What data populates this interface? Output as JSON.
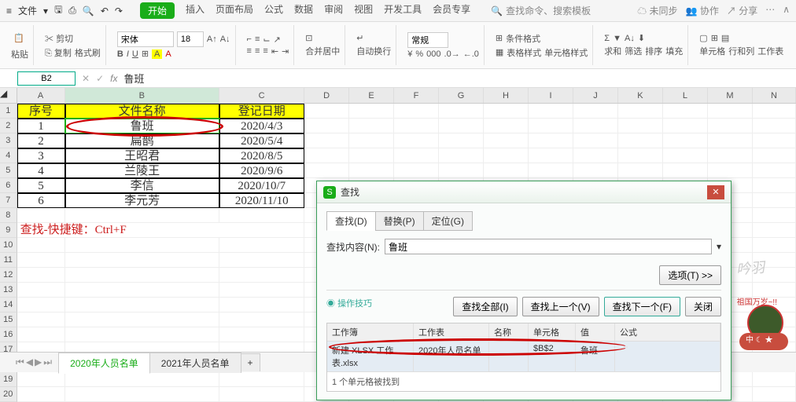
{
  "menubar": {
    "file": "文件",
    "items": [
      "开始",
      "插入",
      "页面布局",
      "公式",
      "数据",
      "审阅",
      "视图",
      "开发工具",
      "会员专享"
    ],
    "search_placeholder": "查找命令、搜索模板",
    "right": [
      "未同步",
      "协作",
      "分享"
    ]
  },
  "toolbar": {
    "paste": "粘贴",
    "cut": "剪切",
    "copy": "复制",
    "format_painter": "格式刷",
    "font_name": "宋体",
    "font_size": "18",
    "merge": "合并居中",
    "wrap": "自动换行",
    "general": "常规",
    "cond_fmt": "条件格式",
    "table_style": "表格样式",
    "cell_style": "单元格样式",
    "sum": "求和",
    "filter": "筛选",
    "sort": "排序",
    "fill": "填充",
    "cell": "单元格",
    "rowcol": "行和列",
    "ws": "工作表"
  },
  "namebox": {
    "ref": "B2",
    "fx": "fx",
    "val": "鲁班"
  },
  "cols": [
    "A",
    "B",
    "C",
    "D",
    "E",
    "F",
    "G",
    "H",
    "I",
    "J",
    "K",
    "L",
    "M",
    "N"
  ],
  "widths": [
    62,
    200,
    110,
    58,
    58,
    58,
    58,
    58,
    58,
    58,
    58,
    58,
    58,
    56
  ],
  "table": {
    "headers": [
      "序号",
      "文件名称",
      "登记日期"
    ],
    "rows": [
      [
        "1",
        "鲁班",
        "2020/4/3"
      ],
      [
        "2",
        "扁鹊",
        "2020/5/4"
      ],
      [
        "3",
        "王昭君",
        "2020/8/5"
      ],
      [
        "4",
        "兰陵王",
        "2020/9/6"
      ],
      [
        "5",
        "李信",
        "2020/10/7"
      ],
      [
        "6",
        "李元芳",
        "2020/11/10"
      ]
    ]
  },
  "note": "查找-快捷键：Ctrl+F",
  "dialog": {
    "title": "查找",
    "tabs": [
      "查找(D)",
      "替换(P)",
      "定位(G)"
    ],
    "find_label": "查找内容(N):",
    "find_value": "鲁班",
    "options_btn": "选项(T) >>",
    "tips": "操作技巧",
    "btns": [
      "查找全部(I)",
      "查找上一个(V)",
      "查找下一个(F)",
      "关闭"
    ],
    "res_head": [
      "工作簿",
      "工作表",
      "名称",
      "单元格",
      "值",
      "公式"
    ],
    "res_row": [
      "新建 XLSX 工作表.xlsx",
      "2020年人员名单",
      "",
      "$B$2",
      "鲁班",
      ""
    ],
    "res_foot": "1 个单元格被找到"
  },
  "sheets": [
    "2020年人员名单",
    "2021年人员名单"
  ],
  "watermark": "吟羽",
  "chart_data": {
    "type": "table",
    "title": "人员名单",
    "columns": [
      "序号",
      "文件名称",
      "登记日期"
    ],
    "rows": [
      [
        1,
        "鲁班",
        "2020/4/3"
      ],
      [
        2,
        "扁鹊",
        "2020/5/4"
      ],
      [
        3,
        "王昭君",
        "2020/8/5"
      ],
      [
        4,
        "兰陵王",
        "2020/9/6"
      ],
      [
        5,
        "李信",
        "2020/10/7"
      ],
      [
        6,
        "李元芳",
        "2020/11/10"
      ]
    ]
  }
}
